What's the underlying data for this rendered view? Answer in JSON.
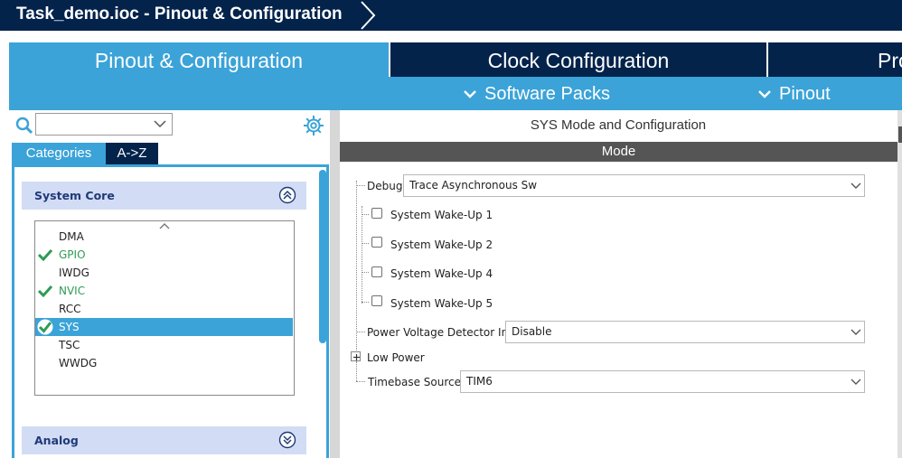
{
  "window": {
    "title": "Task_demo.ioc - Pinout & Configuration"
  },
  "main_tabs": [
    {
      "label": "Pinout & Configuration",
      "active": true
    },
    {
      "label": "Clock Configuration",
      "active": false
    },
    {
      "label": "Pro",
      "active": false
    }
  ],
  "sub_tabs": [
    {
      "label": "Software Packs",
      "icon": "chevron-down-icon"
    },
    {
      "label": "Pinout",
      "icon": "chevron-down-icon"
    }
  ],
  "left": {
    "search": {
      "value": "",
      "placeholder": ""
    },
    "view_tabs": [
      {
        "label": "Categories",
        "active": true
      },
      {
        "label": "A->Z",
        "active": false
      }
    ],
    "categories": [
      {
        "label": "System Core",
        "expanded": true,
        "items": [
          {
            "label": "DMA",
            "status": "none",
            "selected": false
          },
          {
            "label": "GPIO",
            "status": "configured",
            "selected": false
          },
          {
            "label": "IWDG",
            "status": "none",
            "selected": false
          },
          {
            "label": "NVIC",
            "status": "configured",
            "selected": false
          },
          {
            "label": "RCC",
            "status": "none",
            "selected": false
          },
          {
            "label": "SYS",
            "status": "configured",
            "selected": true
          },
          {
            "label": "TSC",
            "status": "none",
            "selected": false
          },
          {
            "label": "WWDG",
            "status": "none",
            "selected": false
          }
        ]
      },
      {
        "label": "Analog",
        "expanded": false,
        "items": []
      }
    ]
  },
  "right": {
    "title": "SYS Mode and Configuration",
    "mode_header": "Mode",
    "debug": {
      "label": "Debug",
      "value": "Trace Asynchronous Sw"
    },
    "checkboxes": [
      {
        "label": "System Wake-Up 1",
        "checked": false
      },
      {
        "label": "System Wake-Up 2",
        "checked": false
      },
      {
        "label": "System Wake-Up 4",
        "checked": false
      },
      {
        "label": "System Wake-Up 5",
        "checked": false
      }
    ],
    "pvd": {
      "label": "Power Voltage Detector In",
      "value": "Disable"
    },
    "low_power": {
      "label": "Low Power"
    },
    "timebase": {
      "label": "Timebase Source",
      "value": "TIM6"
    }
  },
  "colors": {
    "navy": "#03234b",
    "accent_blue": "#3ba3d8",
    "configured_green": "#2e9b55",
    "category_header_bg": "#d2dcf4"
  }
}
